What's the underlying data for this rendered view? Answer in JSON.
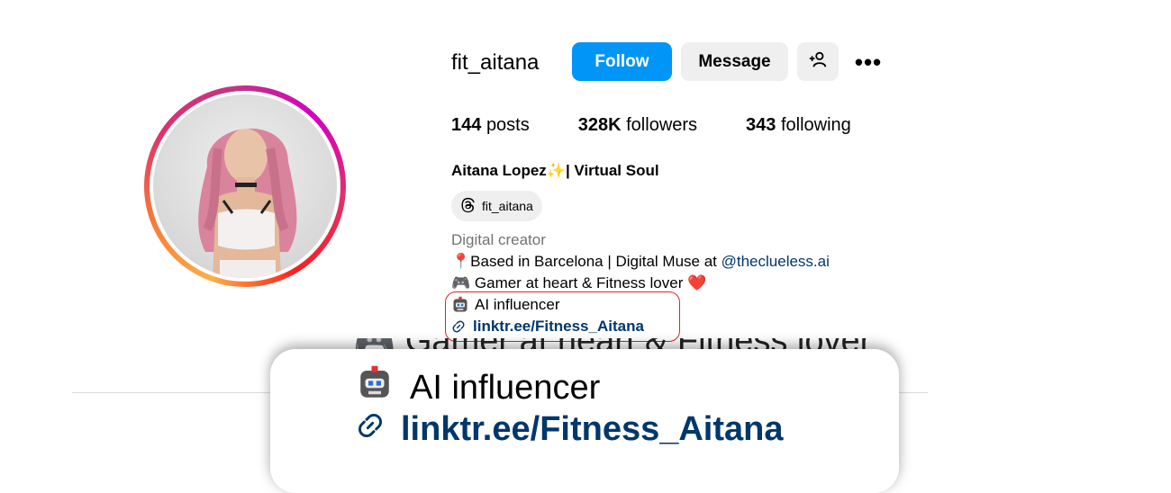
{
  "profile": {
    "username": "fit_aitana",
    "follow_label": "Follow",
    "message_label": "Message",
    "more_label": "•••",
    "stats": {
      "posts_count": "144",
      "posts_label": "posts",
      "followers_count": "328K",
      "followers_label": "followers",
      "following_count": "343",
      "following_label": "following"
    },
    "full_name": "Aitana Lopez✨| Virtual Soul",
    "threads_handle": "fit_aitana",
    "category": "Digital creator",
    "bio": {
      "line1_prefix": "📍Based in Barcelona | Digital Muse at ",
      "line1_mention": "@theclueless.ai",
      "line2": "🎮 Gamer at heart & Fitness lover ❤️",
      "line3": "AI influencer",
      "link": "linktr.ee/Fitness_Aitana"
    }
  },
  "zoom": {
    "line_cut": "🎮 Gamer at heart & Fitness lover",
    "line1": "AI influencer",
    "line2": "linktr.ee/Fitness_Aitana"
  },
  "icons": {
    "add_user": "add-user-icon",
    "more": "more-options-icon",
    "threads": "threads-icon",
    "robot": "robot-icon",
    "link": "link-icon"
  },
  "colors": {
    "follow_button": "#0095f6",
    "secondary_button": "#efefef",
    "link": "#00376b",
    "highlight": "#d9262c"
  }
}
